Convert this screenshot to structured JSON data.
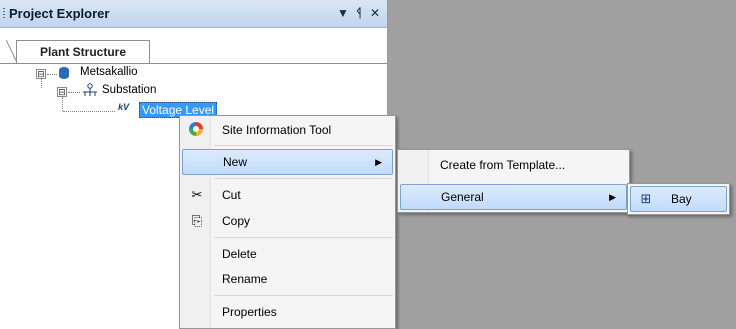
{
  "panel": {
    "title": "Project Explorer",
    "buttons": {
      "dropdown": "▼",
      "pin": "ᛩ",
      "close": "✕"
    },
    "tab": "Plant Structure"
  },
  "tree": {
    "root": {
      "label": "Metsakallio",
      "icon": "database-icon",
      "expander": "⊟"
    },
    "child": {
      "label": "Substation",
      "icon": "substation-icon",
      "expander": "⊟"
    },
    "grandchild": {
      "label": "Voltage Level",
      "icon": "voltage-level-icon",
      "icon_text": "kV"
    }
  },
  "context_menu": {
    "items": [
      {
        "label": "Site Information Tool",
        "icon": "site-tool-icon"
      },
      {
        "label": "New",
        "submenu": true
      },
      {
        "label": "Cut",
        "icon": "scissors-icon",
        "glyph": "✂"
      },
      {
        "label": "Copy",
        "icon": "copy-icon",
        "glyph": "⎘"
      },
      {
        "label": "Delete"
      },
      {
        "label": "Rename"
      },
      {
        "label": "Properties"
      }
    ],
    "arrow": "▶"
  },
  "submenu_new": {
    "items": [
      {
        "label": "Create from Template..."
      },
      {
        "label": "General",
        "submenu": true
      }
    ]
  },
  "submenu_general": {
    "items": [
      {
        "label": "Bay",
        "icon": "bay-icon",
        "glyph": "⊞"
      }
    ]
  },
  "colors": {
    "highlight": "#c1dbfc",
    "selection": "#3399ff",
    "workspace": "#a0a0a0"
  }
}
